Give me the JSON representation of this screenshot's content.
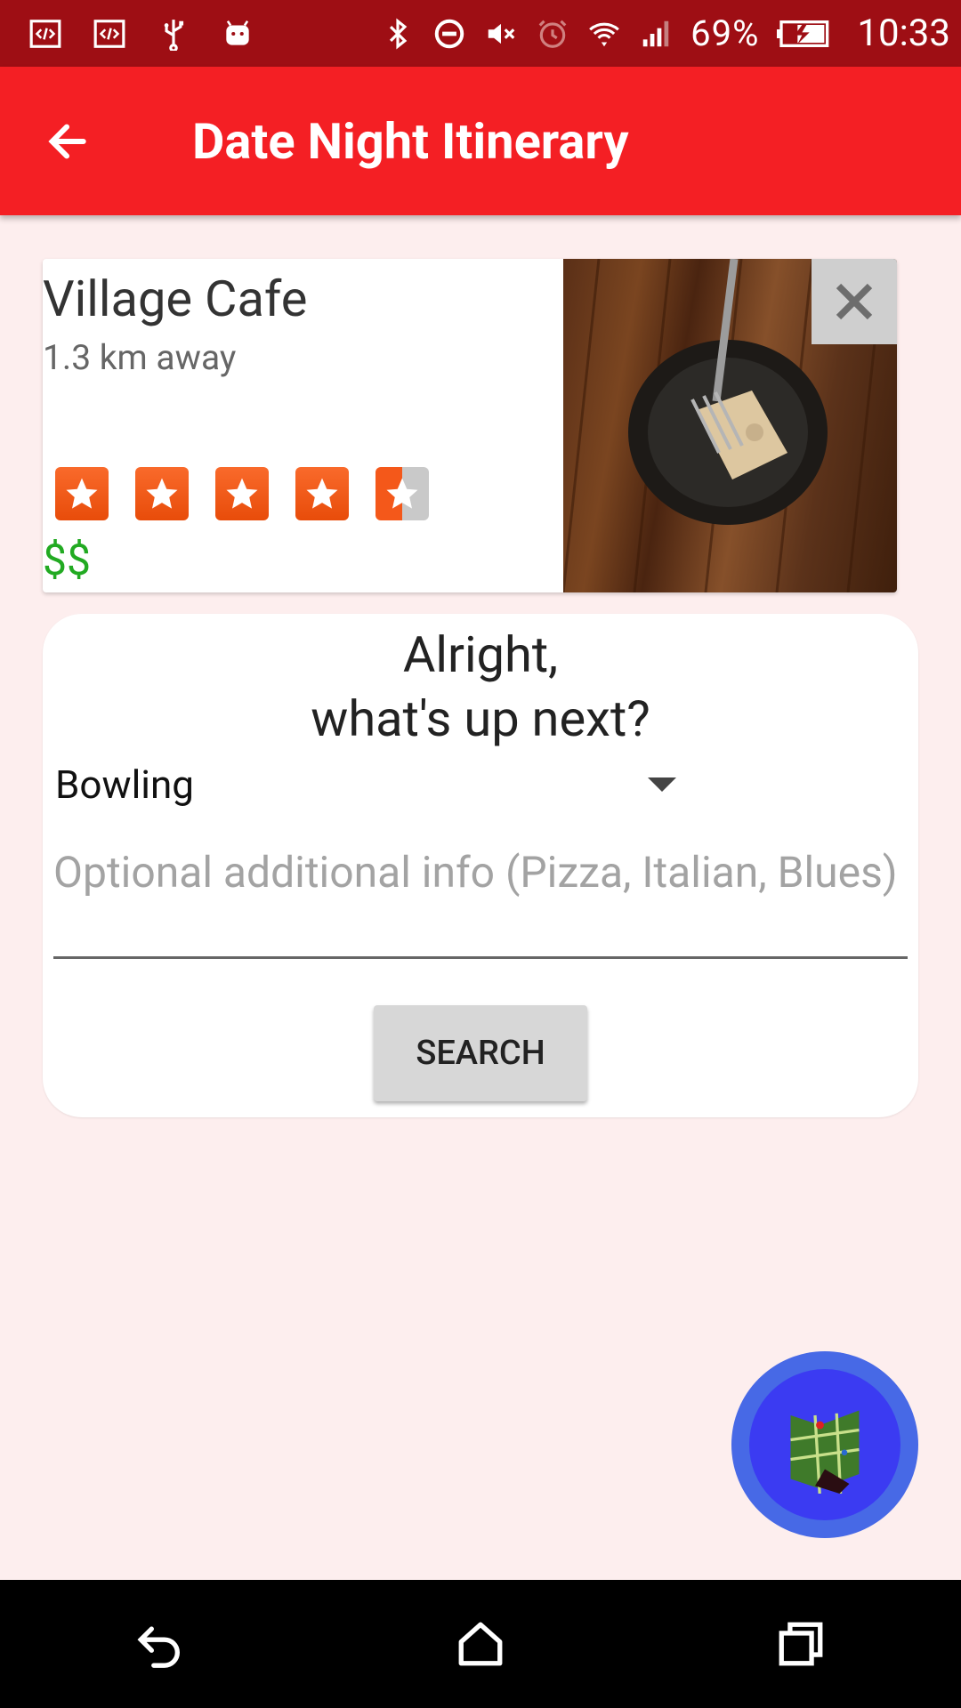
{
  "status_bar": {
    "battery": "69%",
    "time": "10:33",
    "left_icons": [
      "code-icon",
      "code-icon",
      "usb-icon",
      "android-icon"
    ],
    "right_icons": [
      "bluetooth-icon",
      "do-not-disturb-icon",
      "mute-icon",
      "alarm-icon",
      "wifi-icon",
      "signal-icon",
      "battery-charging-icon"
    ]
  },
  "app_bar": {
    "title": "Date Night Itinerary",
    "back_icon": "arrow-back-icon",
    "color": "#f41f24"
  },
  "place": {
    "name": "Village Cafe",
    "distance": "1.3 km away",
    "rating": 4.5,
    "rating_max": 5,
    "price": "$$",
    "price_color": "#22aa22"
  },
  "next": {
    "prompt": "Alright,\nwhat's up next?",
    "category": "Bowling",
    "info_placeholder": "Optional additional info (Pizza, Italian, Blues)",
    "search_label": "SEARCH"
  },
  "fab": {
    "icon": "map-icon",
    "color": "#4769e6"
  },
  "nav_bar": {
    "icons": [
      "back-icon",
      "home-icon",
      "recents-icon"
    ]
  }
}
